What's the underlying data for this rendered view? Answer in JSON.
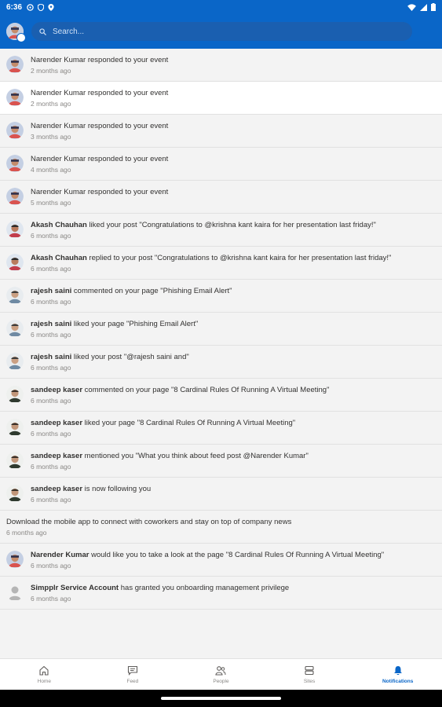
{
  "status": {
    "time": "6:36"
  },
  "search": {
    "placeholder": "Search..."
  },
  "notifications": [
    {
      "actor": "",
      "text": "Narender Kumar responded to your event",
      "time": "2 months ago",
      "avatar": "nk"
    },
    {
      "actor": "",
      "text": "Narender Kumar responded to your event",
      "time": "2 months ago",
      "avatar": "nk",
      "highlight": true
    },
    {
      "actor": "",
      "text": "Narender Kumar responded to your event",
      "time": "3 months ago",
      "avatar": "nk"
    },
    {
      "actor": "",
      "text": "Narender Kumar responded to your event",
      "time": "4 months ago",
      "avatar": "nk"
    },
    {
      "actor": "",
      "text": "Narender Kumar responded to your event",
      "time": "5 months ago",
      "avatar": "nk"
    },
    {
      "actor": "Akash Chauhan",
      "text": " liked your post \"Congratulations to @krishna kant kaira for her presentation last friday!\"",
      "time": "6 months ago",
      "avatar": "ac"
    },
    {
      "actor": "Akash Chauhan",
      "text": " replied to your post \"Congratulations to @krishna kant kaira for her presentation last friday!\"",
      "time": "6 months ago",
      "avatar": "ac"
    },
    {
      "actor": "rajesh saini",
      "text": " commented on your page \"Phishing Email Alert\"",
      "time": "6 months ago",
      "avatar": "rs"
    },
    {
      "actor": "rajesh saini",
      "text": " liked your page \"Phishing Email Alert\"",
      "time": "6 months ago",
      "avatar": "rs"
    },
    {
      "actor": "rajesh saini",
      "text": " liked your post \"@rajesh saini and\"",
      "time": "6 months ago",
      "avatar": "rs"
    },
    {
      "actor": "sandeep kaser",
      "text": " commented on your page \"8 Cardinal Rules Of Running A Virtual Meeting\"",
      "time": "6 months ago",
      "avatar": "sk"
    },
    {
      "actor": "sandeep kaser",
      "text": " liked your page \"8 Cardinal Rules Of Running A Virtual Meeting\"",
      "time": "6 months ago",
      "avatar": "sk"
    },
    {
      "actor": "sandeep kaser",
      "text": " mentioned you \"What you think about feed post @Narender Kumar\"",
      "time": "6 months ago",
      "avatar": "sk"
    },
    {
      "actor": "sandeep kaser",
      "text": " is now following you",
      "time": "6 months ago",
      "avatar": "sk"
    }
  ],
  "promo": {
    "text": "Download the mobile app to connect with coworkers and stay on top of company news",
    "time": "6 months ago"
  },
  "notifications2": [
    {
      "actor": "Narender Kumar",
      "text": " would like you to take a look at the page \"8 Cardinal Rules Of Running A Virtual Meeting\"",
      "time": "6 months ago",
      "avatar": "nk"
    },
    {
      "actor": "Simpplr Service Account",
      "text": " has granted you onboarding management privilege",
      "time": "6 months ago",
      "avatar": "default"
    }
  ],
  "nav": {
    "tabs": [
      {
        "label": "Home",
        "icon": "home-icon"
      },
      {
        "label": "Feed",
        "icon": "feed-icon"
      },
      {
        "label": "People",
        "icon": "people-icon"
      },
      {
        "label": "Sites",
        "icon": "sites-icon"
      },
      {
        "label": "Notifications",
        "icon": "bell-icon",
        "active": true
      }
    ]
  },
  "colors": {
    "brand": "#0a66c8",
    "background": "#f3f3f3",
    "highlight": "#ffffff"
  }
}
